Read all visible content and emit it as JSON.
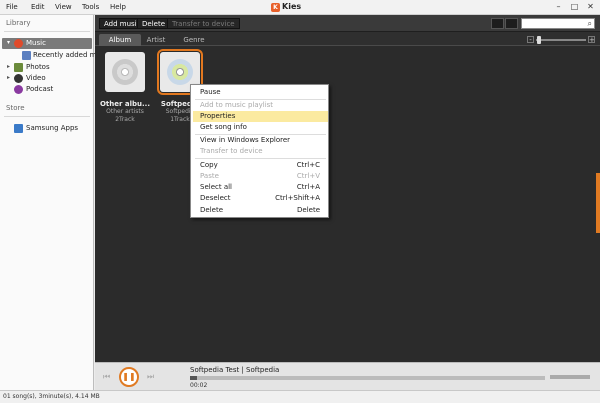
{
  "menu": [
    "File",
    "Edit",
    "View",
    "Tools",
    "Help"
  ],
  "app_title": "Kies",
  "app_logo": "K",
  "window_controls": [
    "–",
    "□",
    "✕"
  ],
  "sidebar": {
    "library_heading": "Library",
    "items": [
      {
        "label": "Music",
        "icon": "music-icon",
        "expanded": true,
        "active": true
      },
      {
        "label": "Recently added m...",
        "icon": "playlist-icon"
      },
      {
        "label": "Photos",
        "icon": "photos-icon"
      },
      {
        "label": "Video",
        "icon": "video-icon"
      },
      {
        "label": "Podcast",
        "icon": "podcast-icon"
      }
    ],
    "store_heading": "Store",
    "store_items": [
      {
        "label": "Samsung Apps",
        "icon": "samsung-apps-icon"
      }
    ]
  },
  "toolbar": {
    "add_music": "Add music",
    "delete": "Delete",
    "transfer": "Transfer to device",
    "search_placeholder": ""
  },
  "tabs": [
    {
      "label": "Album",
      "active": true
    },
    {
      "label": "Artist",
      "active": false
    },
    {
      "label": "Genre",
      "active": false
    }
  ],
  "albums": [
    {
      "title": "Other albu...",
      "artist": "Other artists",
      "tracks": "2Track"
    },
    {
      "title": "Softpedia",
      "artist": "Softpedia",
      "tracks": "1Track"
    }
  ],
  "context_menu": [
    {
      "label": "Pause",
      "shortcut": "",
      "disabled": false
    },
    {
      "label": "Add to music playlist",
      "shortcut": "",
      "disabled": true
    },
    {
      "label": "Properties",
      "shortcut": "",
      "disabled": false,
      "highlighted": true
    },
    {
      "label": "Get song info",
      "shortcut": "",
      "disabled": false
    },
    {
      "label": "View in Windows Explorer",
      "shortcut": "",
      "disabled": false
    },
    {
      "label": "Transfer to device",
      "shortcut": "",
      "disabled": true
    },
    {
      "label": "Copy",
      "shortcut": "Ctrl+C",
      "disabled": false
    },
    {
      "label": "Paste",
      "shortcut": "Ctrl+V",
      "disabled": true
    },
    {
      "label": "Select all",
      "shortcut": "Ctrl+A",
      "disabled": false
    },
    {
      "label": "Deselect",
      "shortcut": "Ctrl+Shift+A",
      "disabled": false
    },
    {
      "label": "Delete",
      "shortcut": "Delete",
      "disabled": false
    }
  ],
  "player": {
    "track": "Softpedia Test | Softpedia",
    "elapsed": "00:02",
    "progress_fraction": 0.02,
    "prev_icon": "⏮",
    "play_icon": "❚❚",
    "next_icon": "⏭"
  },
  "status": "01 song(s), 3minute(s), 4.14 MB",
  "colors": {
    "accent": "#e07a22",
    "highlight": "#fbeaa0",
    "main_bg": "#2b2b2b"
  }
}
